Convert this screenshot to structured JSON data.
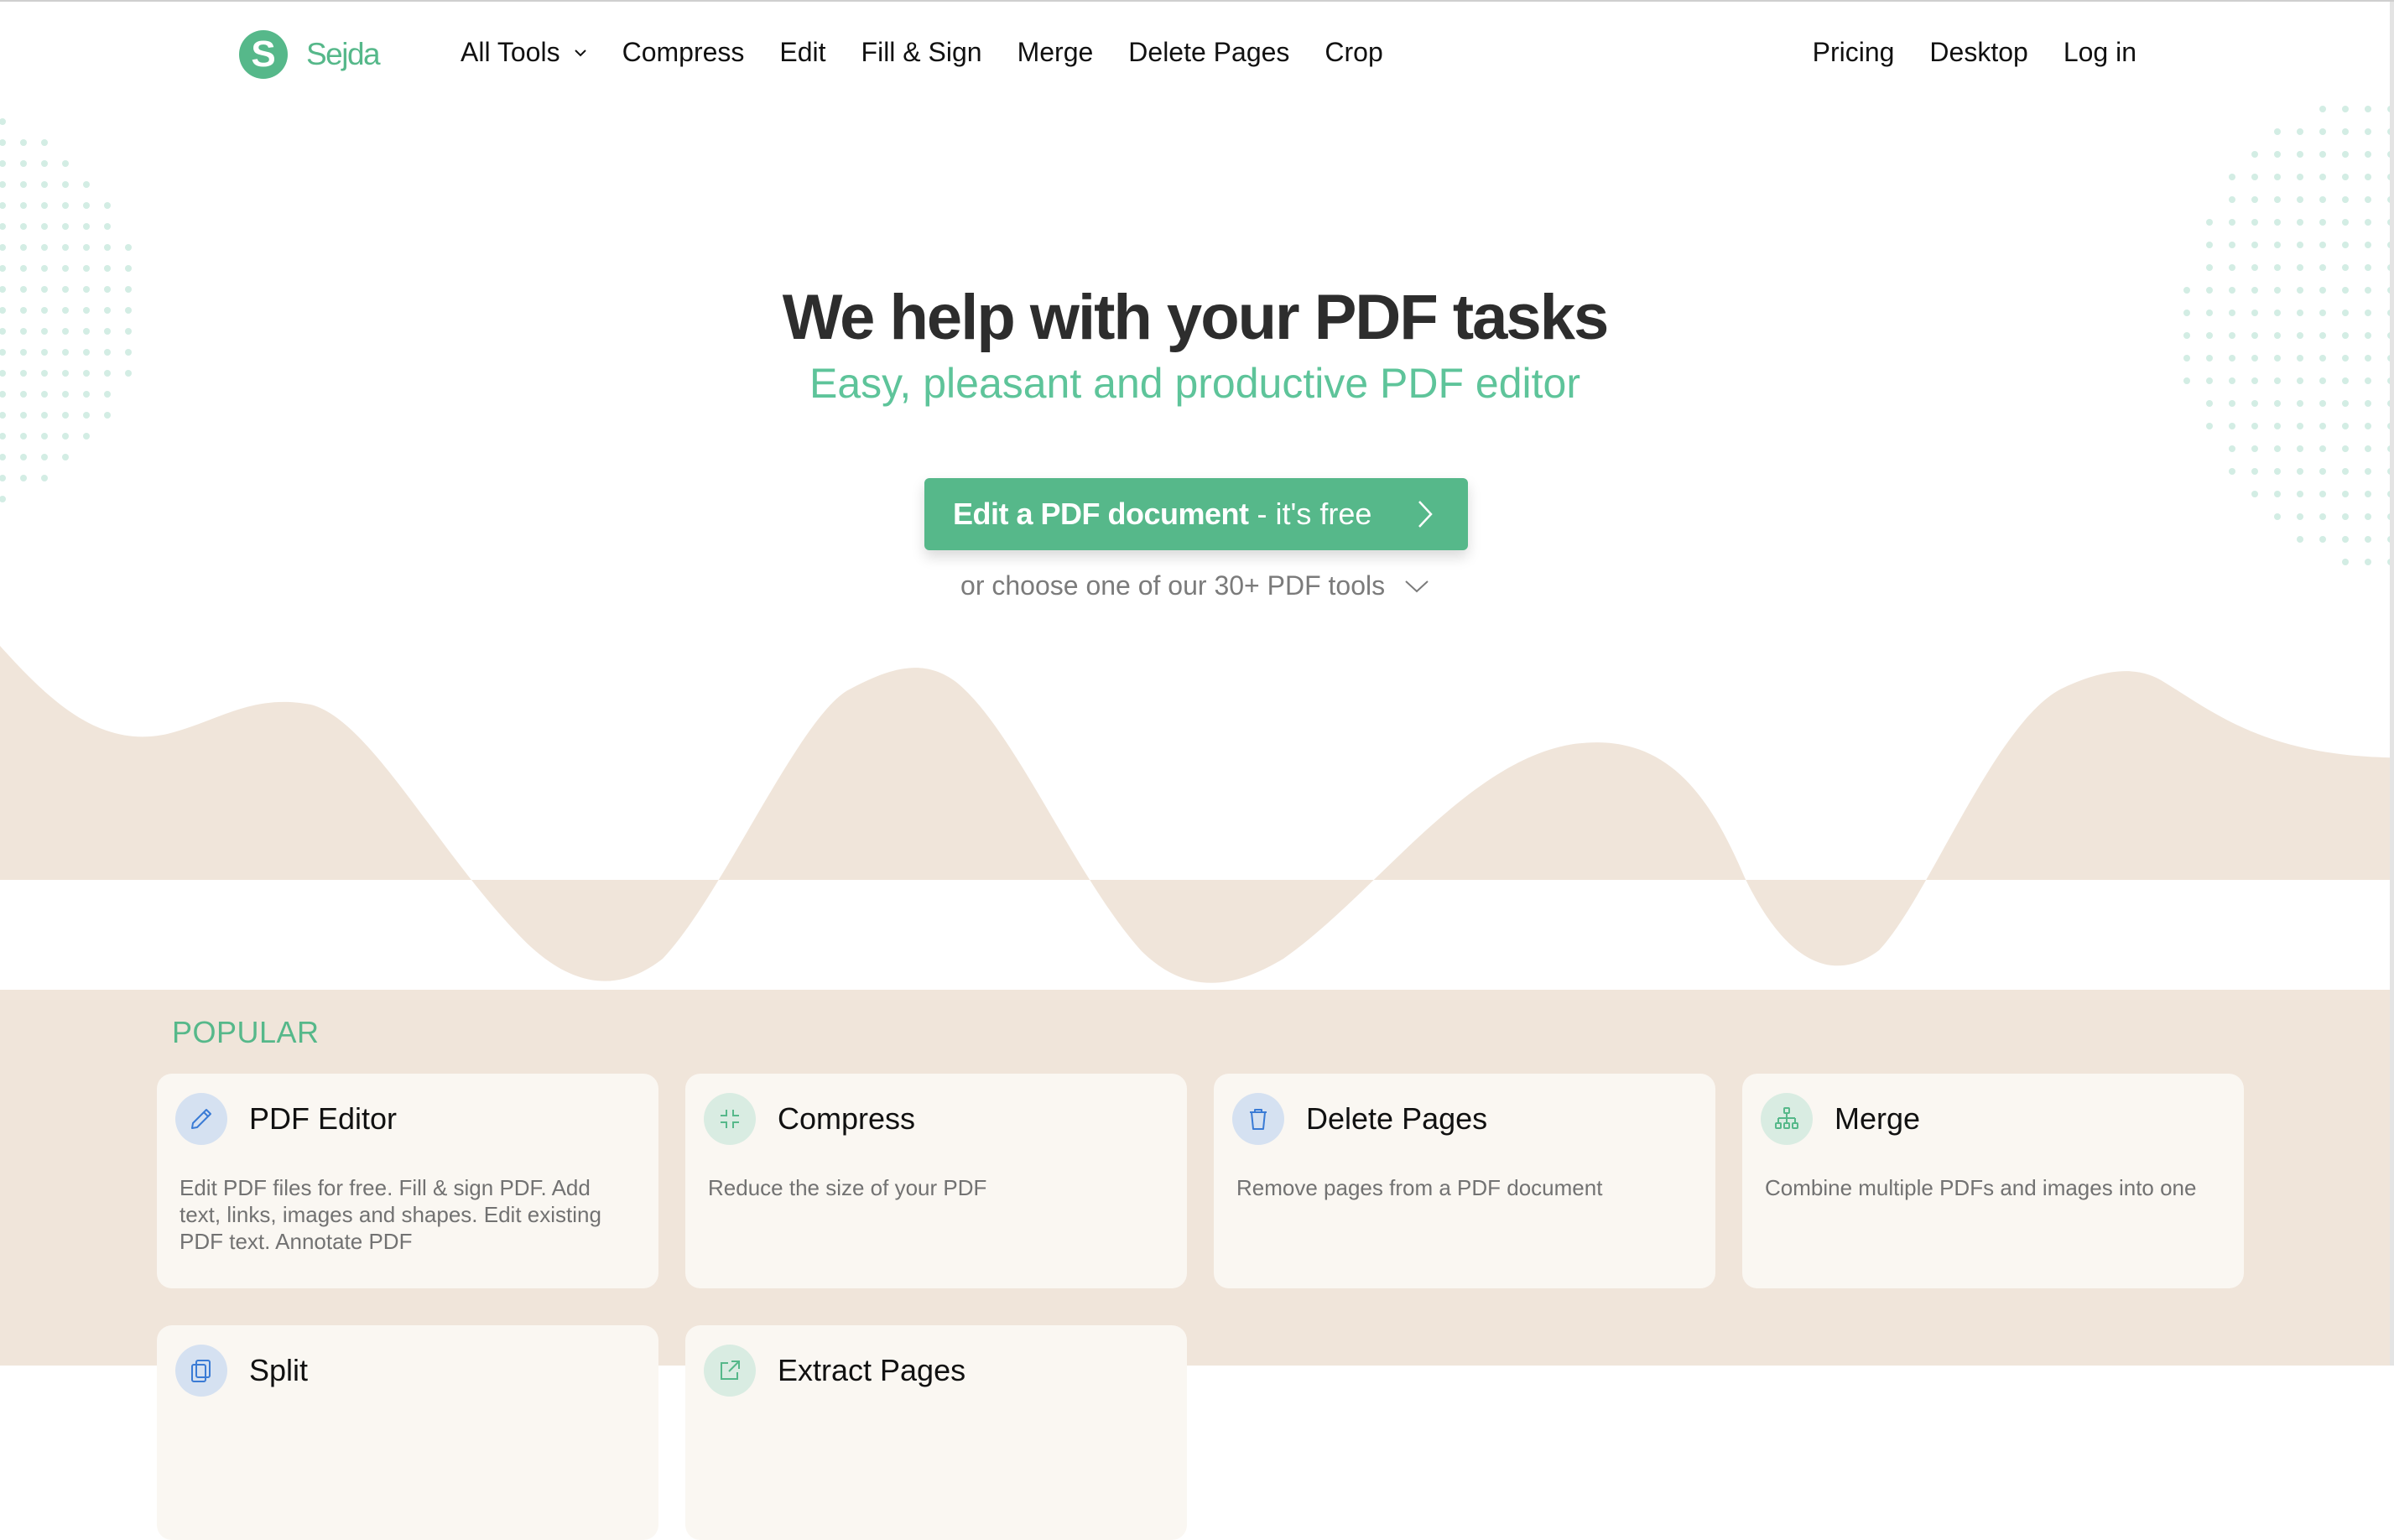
{
  "brand": {
    "logo_letter": "S",
    "name": "Sejda",
    "accent_color": "#56b88a",
    "beige_color": "#f0e5da"
  },
  "nav": {
    "left": [
      {
        "label": "All Tools",
        "has_dropdown": true
      },
      {
        "label": "Compress"
      },
      {
        "label": "Edit"
      },
      {
        "label": "Fill & Sign"
      },
      {
        "label": "Merge"
      },
      {
        "label": "Delete Pages"
      },
      {
        "label": "Crop"
      }
    ],
    "right": [
      {
        "label": "Pricing"
      },
      {
        "label": "Desktop"
      },
      {
        "label": "Log in"
      }
    ]
  },
  "hero": {
    "title": "We help with your PDF tasks",
    "subtitle": "Easy, pleasant and productive PDF editor",
    "cta_strong": "Edit a PDF document",
    "cta_light": "- it's free",
    "more_tools": "or choose one of our 30+ PDF tools"
  },
  "popular": {
    "heading": "POPULAR",
    "cards": [
      {
        "title": "PDF Editor",
        "icon": "pencil-icon",
        "description": "Edit PDF files for free. Fill & sign PDF. Add text, links, images and shapes. Edit existing PDF text. Annotate PDF"
      },
      {
        "title": "Compress",
        "icon": "compress-icon",
        "description": "Reduce the size of your PDF"
      },
      {
        "title": "Delete Pages",
        "icon": "trash-icon",
        "description": "Remove pages from a PDF document"
      },
      {
        "title": "Merge",
        "icon": "sitemap-icon",
        "description": "Combine multiple PDFs and images into one"
      },
      {
        "title": "Split",
        "icon": "split-icon",
        "description": ""
      },
      {
        "title": "Extract Pages",
        "icon": "extract-icon",
        "description": ""
      }
    ]
  }
}
